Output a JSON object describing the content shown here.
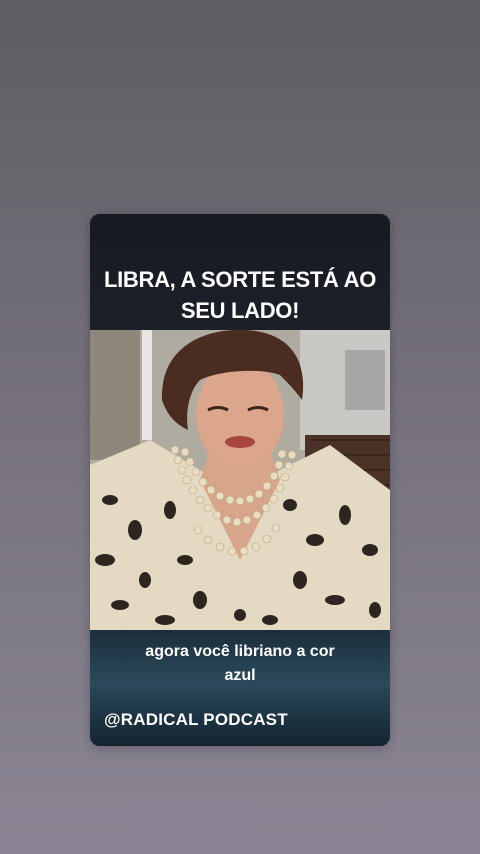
{
  "story": {
    "headline_line1": "LIBRA, A SORTE ESTÁ AO",
    "headline_line2": "SEU LADO!",
    "caption_line1": "agora você libriano a cor",
    "caption_line2": "azul",
    "watermark": "@RADICAL PODCAST"
  },
  "colors": {
    "page_background": "#6e6a73",
    "card_dark": "#171a22",
    "caption_band": "#2b4a5b",
    "text": "#ffffff"
  }
}
